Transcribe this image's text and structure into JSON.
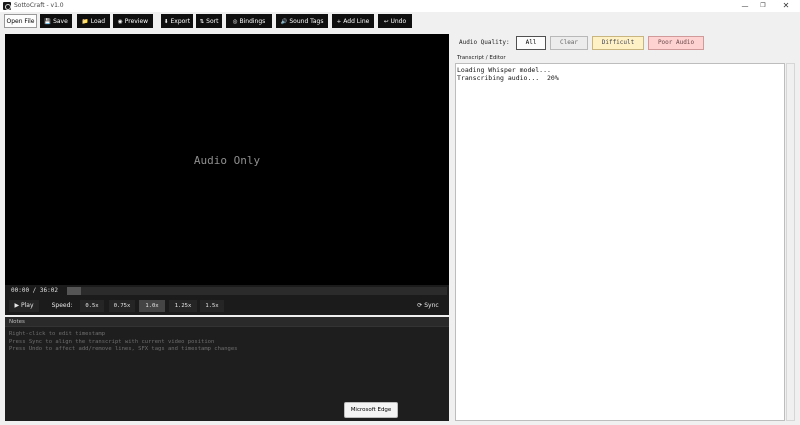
{
  "window": {
    "title": "SottoCraft - v1.0",
    "controls": {
      "minimize": "—",
      "restore": "❐",
      "close": "✕"
    }
  },
  "toolbar": {
    "open_file": "Open File",
    "save": "Save",
    "load": "Load",
    "preview": "Preview",
    "export": "Export",
    "sort": "Sort",
    "bindings": "Bindings",
    "sound_tags": "Sound Tags",
    "add_line": "Add Line",
    "undo": "Undo",
    "icons": {
      "save": "💾",
      "load": "📁",
      "preview": "◉",
      "export": "⬇",
      "sort": "⇅",
      "bindings": "◎",
      "sound_tags": "🔊",
      "add_line": "+",
      "undo": "↩"
    }
  },
  "player": {
    "placeholder": "Audio Only",
    "time": "00:00 / 36:02",
    "progress": 0.0
  },
  "controls": {
    "play": "▶ Play",
    "speed_label": "Speed:",
    "speeds": [
      "0.5x",
      "0.75x",
      "1.0x",
      "1.25x",
      "1.5x"
    ],
    "active_speed": "1.0x",
    "sync": "⟳ Sync"
  },
  "notes": {
    "title": "Notes",
    "lines": [
      "Right-click to edit timestamp",
      "Press Sync to align the transcript with current video position",
      "Press Undo to affect add/remove lines, SFX tags and timestamp changes"
    ]
  },
  "tooltip": {
    "text": "Microsoft Edge"
  },
  "quality": {
    "label": "Audio Quality:",
    "all": "All",
    "clear": "Clear",
    "difficult": "Difficult",
    "poor": "Poor Audio"
  },
  "editor": {
    "label": "Transcript / Editor",
    "lines": [
      "Loading Whisper model...",
      "Transcribing audio...  20%"
    ]
  }
}
